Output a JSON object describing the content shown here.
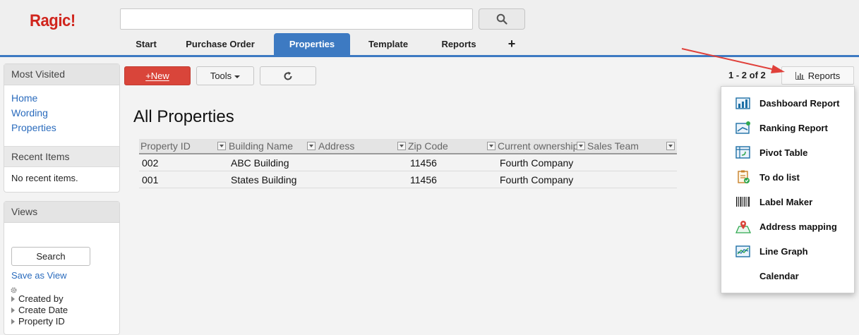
{
  "app": {
    "logo": "Ragic!"
  },
  "search": {
    "placeholder": ""
  },
  "tabs": [
    "Start",
    "Purchase Order",
    "Properties",
    "Template",
    "Reports",
    "+"
  ],
  "sidebar": {
    "most_visited_title": "Most Visited",
    "links": [
      "Home",
      "Wording",
      "Properties"
    ],
    "recent_title": "Recent Items",
    "recent_empty": "No recent items.",
    "views_title": "Views",
    "search_button": "Search",
    "save_view": "Save as View",
    "fields": [
      "Created by",
      "Create Date",
      "Property ID"
    ]
  },
  "toolbar": {
    "new_label": "+New",
    "tools_label": "Tools"
  },
  "page_title": "All Properties",
  "table": {
    "columns": [
      "Property ID",
      "Building Name",
      "Address",
      "Zip Code",
      "Current ownership",
      "Sales Team"
    ],
    "rows": [
      [
        "002",
        "ABC Building",
        "",
        "11456",
        "Fourth Company",
        ""
      ],
      [
        "001",
        "States Building",
        "",
        "11456",
        "Fourth Company",
        ""
      ]
    ]
  },
  "pagination": {
    "range": "1 - 2 of 2"
  },
  "reports": {
    "button": "Reports",
    "items": [
      {
        "label": "Dashboard Report",
        "icon": "dashboard-report-icon"
      },
      {
        "label": "Ranking Report",
        "icon": "ranking-report-icon"
      },
      {
        "label": "Pivot Table",
        "icon": "pivot-table-icon"
      },
      {
        "label": "To do list",
        "icon": "todo-list-icon"
      },
      {
        "label": "Label Maker",
        "icon": "barcode-icon"
      },
      {
        "label": "Address mapping",
        "icon": "map-pin-icon"
      },
      {
        "label": "Line Graph",
        "icon": "line-graph-icon"
      },
      {
        "label": "Calendar",
        "icon": ""
      }
    ]
  },
  "colors": {
    "accent": "#3d7ac2",
    "logo": "#d0251d",
    "new_button": "#d9453a",
    "arrow": "#e0403a"
  }
}
